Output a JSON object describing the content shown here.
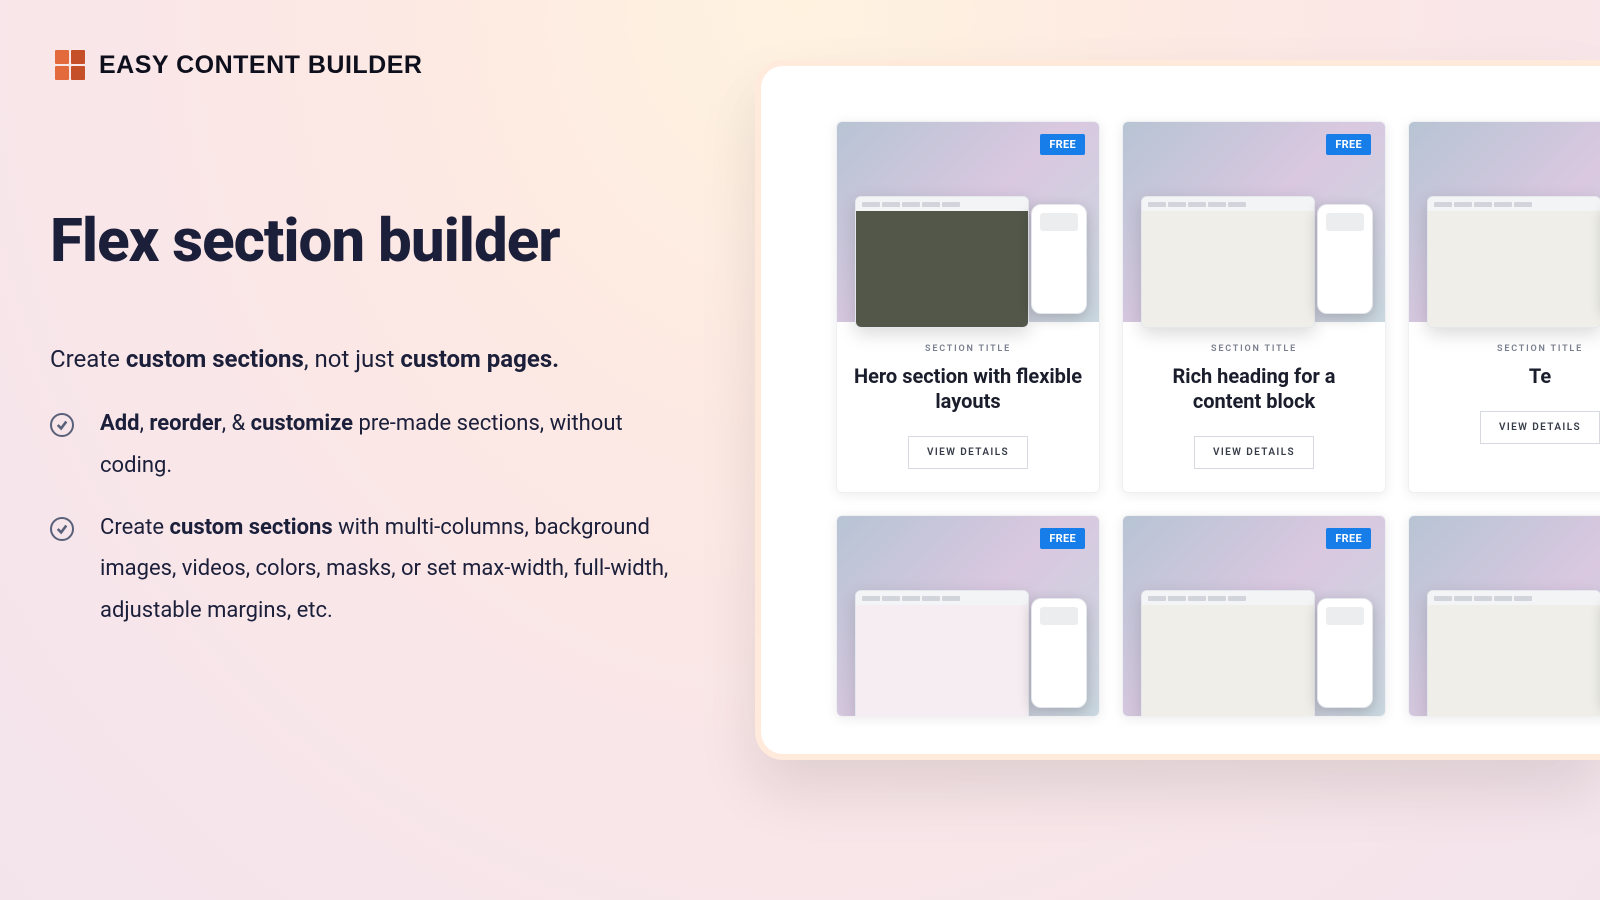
{
  "brand": {
    "name": "EASY CONTENT BUILDER"
  },
  "headline": "Flex section builder",
  "subline": {
    "text_before_1": "Create ",
    "strong_1": "custom sections",
    "text_mid": ", not just ",
    "strong_2": "custom pages."
  },
  "bullets": [
    {
      "runs": [
        {
          "text": "Add",
          "bold": true
        },
        {
          "text": ", ",
          "bold": false
        },
        {
          "text": "reorder",
          "bold": true
        },
        {
          "text": ", & ",
          "bold": false
        },
        {
          "text": "customize",
          "bold": true
        },
        {
          "text": " pre-made sections, without coding.",
          "bold": false
        }
      ]
    },
    {
      "runs": [
        {
          "text": "Create ",
          "bold": false
        },
        {
          "text": "custom sections",
          "bold": true
        },
        {
          "text": " with multi-columns, background images, videos, colors, masks, or set max-width, full-width, adjustable margins, etc.",
          "bold": false
        }
      ]
    }
  ],
  "cards": {
    "kicker": "SECTION TITLE",
    "view_label": "VIEW DETAILS",
    "tag_label": "FREE",
    "row1": [
      {
        "title": "Hero section with flexible layouts"
      },
      {
        "title": "Rich heading for a content block"
      },
      {
        "title": "Te"
      }
    ]
  }
}
